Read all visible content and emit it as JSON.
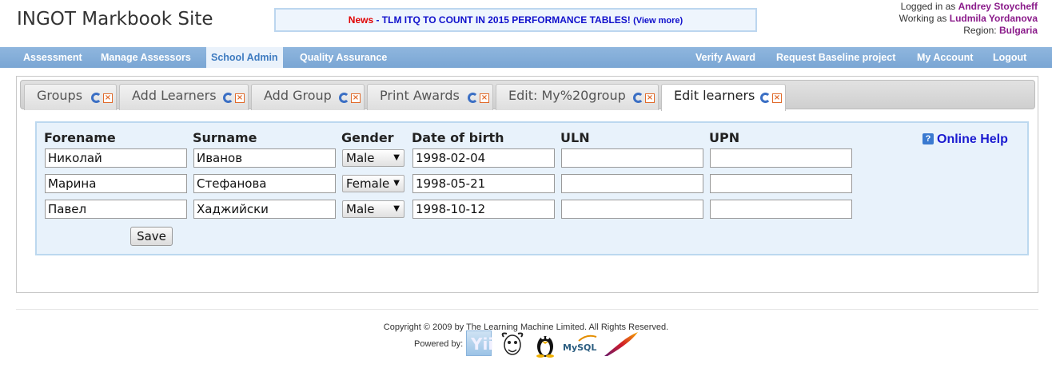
{
  "header": {
    "site_title": "INGOT Markbook Site",
    "news_label": "News",
    "news_text": " - TLM ITQ TO COUNT IN 2015 PERFORMANCE TABLES!",
    "news_more": "(View more)",
    "logged_in_label": "Logged in as",
    "logged_in_user": "Andrey Stoycheff",
    "working_as_label": "Working as",
    "working_as_user": "Ludmila Yordanova",
    "region_label": "Region:",
    "region_value": "Bulgaria"
  },
  "nav": {
    "left": [
      "Assessment",
      "Manage Assessors",
      "School Admin",
      "Quality Assurance"
    ],
    "right": [
      "Verify Award",
      "Request Baseline project",
      "My Account",
      "Logout"
    ],
    "active": "School Admin"
  },
  "tabs": [
    {
      "label": "Groups"
    },
    {
      "label": "Add Learners"
    },
    {
      "label": "Add Group"
    },
    {
      "label": "Print Awards"
    },
    {
      "label": "Edit: My%20group"
    },
    {
      "label": "Edit learners",
      "active": true
    }
  ],
  "form": {
    "columns": [
      "Forename",
      "Surname",
      "Gender",
      "Date of birth",
      "ULN",
      "UPN"
    ],
    "rows": [
      {
        "forename": "Николай",
        "surname": "Иванов",
        "gender": "Male",
        "dob": "1998-02-04",
        "uln": "",
        "upn": ""
      },
      {
        "forename": "Марина",
        "surname": "Стефанова",
        "gender": "Female",
        "dob": "1998-05-21",
        "uln": "",
        "upn": ""
      },
      {
        "forename": "Павел",
        "surname": "Хаджийски",
        "gender": "Male",
        "dob": "1998-10-12",
        "uln": "",
        "upn": ""
      }
    ],
    "save_label": "Save",
    "help_label": "Online Help"
  },
  "footer": {
    "copyright": "Copyright © 2009 by The Learning Machine Limited. All Rights Reserved.",
    "powered_by": "Powered by:",
    "logos": [
      "yii-logo",
      "gnu-logo",
      "tux-logo",
      "mysql-logo",
      "apache-feather-logo"
    ],
    "mysql_text": "MySQL"
  },
  "colors": {
    "nav_bg": "#86afdb",
    "news_red": "#e00000",
    "link_blue": "#1010cc",
    "user_purple": "#8a1a8a",
    "form_bg": "#e8f2fb"
  }
}
